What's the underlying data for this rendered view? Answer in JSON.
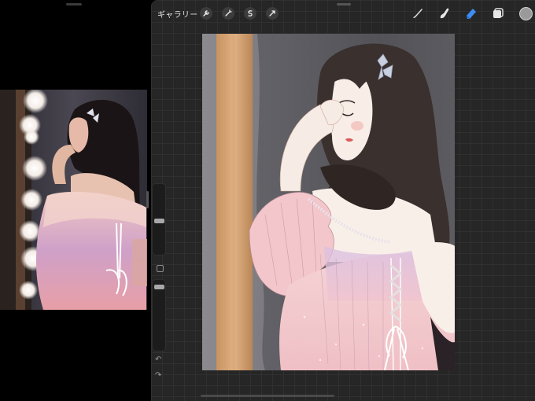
{
  "toolbar": {
    "gallery_label": "ギャラリー",
    "left_tools": [
      "wrench-icon",
      "magic-wand-icon",
      "selection-icon",
      "transform-icon"
    ],
    "right_tools": [
      "brush-icon",
      "smudge-icon",
      "eraser-icon",
      "layers-icon",
      "color-icon"
    ],
    "active_tool": "eraser",
    "accent_color": "#3c8ef5",
    "current_color": "#9a9a9a"
  },
  "sidebar": {
    "brush_size_level": 0.5,
    "opacity_level": 0.5,
    "undo_icon": "↶",
    "redo_icon": "↷"
  },
  "reference": {
    "image": "photo-of-girl-in-pink-lace-dress-at-mirror"
  },
  "canvas": {
    "image": "digital-painting-of-girl-in-pink-dress-with-bow"
  }
}
